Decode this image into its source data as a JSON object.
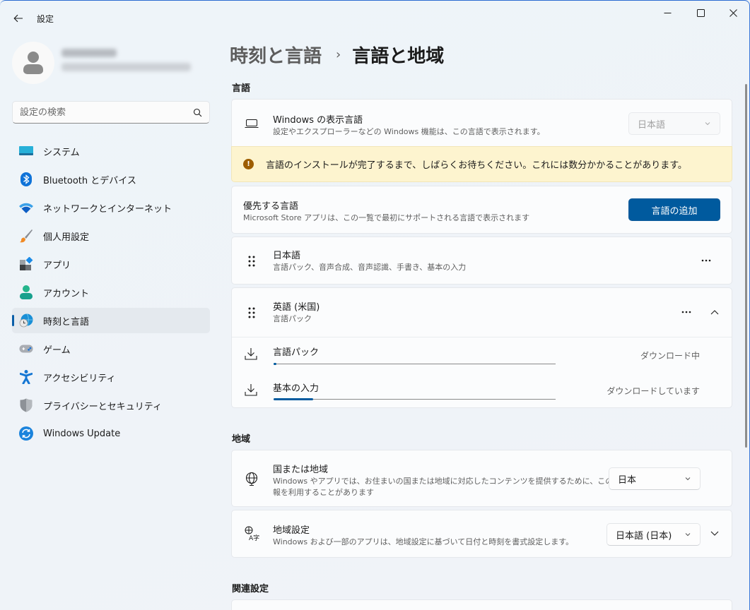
{
  "window": {
    "title": "設定",
    "controls": {
      "minimize": "minimize",
      "maximize": "maximize",
      "close": "close"
    }
  },
  "sidebar": {
    "search_placeholder": "設定の検索",
    "items": [
      {
        "label": "システム",
        "icon": "system-icon",
        "active": false
      },
      {
        "label": "Bluetooth とデバイス",
        "icon": "bluetooth-icon",
        "active": false
      },
      {
        "label": "ネットワークとインターネット",
        "icon": "wifi-icon",
        "active": false
      },
      {
        "label": "個人用設定",
        "icon": "brush-icon",
        "active": false
      },
      {
        "label": "アプリ",
        "icon": "apps-icon",
        "active": false
      },
      {
        "label": "アカウント",
        "icon": "account-icon",
        "active": false
      },
      {
        "label": "時刻と言語",
        "icon": "time-language-icon",
        "active": true
      },
      {
        "label": "ゲーム",
        "icon": "gamepad-icon",
        "active": false
      },
      {
        "label": "アクセシビリティ",
        "icon": "accessibility-icon",
        "active": false
      },
      {
        "label": "プライバシーとセキュリティ",
        "icon": "shield-icon",
        "active": false
      },
      {
        "label": "Windows Update",
        "icon": "update-icon",
        "active": false
      }
    ]
  },
  "breadcrumb": {
    "parent": "時刻と言語",
    "separator": "›",
    "current": "言語と地域"
  },
  "language_section": {
    "title": "言語",
    "display_language": {
      "title": "Windows の表示言語",
      "desc": "設定やエクスプローラーなどの Windows 機能は、この言語で表示されます。",
      "value": "日本語",
      "disabled": true
    },
    "banner": "言語のインストールが完了するまで、しばらくお待ちください。これには数分かかることがあります。",
    "preferred": {
      "title": "優先する言語",
      "desc": "Microsoft Store アプリは、この一覧で最初にサポートされる言語で表示されます",
      "add_button": "言語の追加"
    },
    "languages": [
      {
        "name": "日本語",
        "features": "言語パック、音声合成、音声認識、手書き、基本の入力"
      },
      {
        "name": "英語 (米国)",
        "features": "言語パック",
        "expanded": true,
        "downloads": [
          {
            "label": "言語パック",
            "status": "ダウンロード中",
            "progress_percent": 1
          },
          {
            "label": "基本の入力",
            "status": "ダウンロードしています",
            "progress_percent": 14
          }
        ]
      }
    ]
  },
  "region_section": {
    "title": "地域",
    "country": {
      "title": "国または地域",
      "desc_line1": "Windows やアプリでは、お住まいの国または地域に対応したコンテンツを提供するために、この情",
      "desc_line2": "報を利用することがあります",
      "value": "日本"
    },
    "regional_format": {
      "title": "地域設定",
      "desc": "Windows および一部のアプリは、地域設定に基づいて日付と時刻を書式設定します。",
      "value": "日本語 (日本)"
    }
  },
  "related_section": {
    "title": "関連設定"
  },
  "colors": {
    "accent": "#005a9e",
    "banner_bg": "#fdf4cf",
    "warning": "#9d5d00"
  }
}
